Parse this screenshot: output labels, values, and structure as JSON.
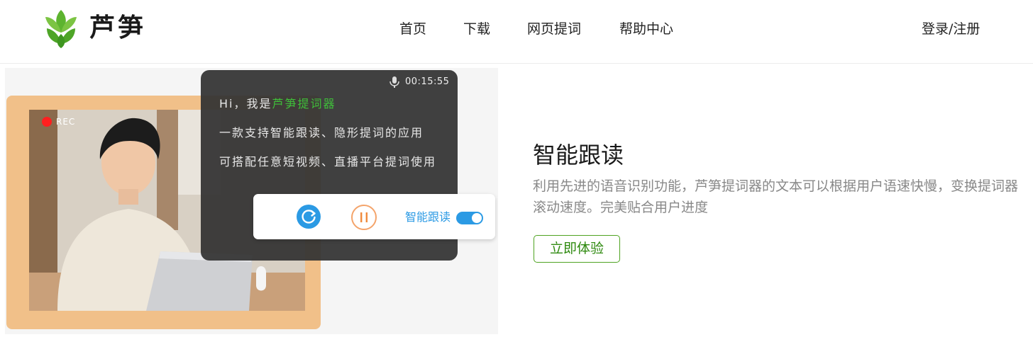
{
  "brand": {
    "name": "芦笋",
    "logo_icon": "leaf-logo-icon",
    "color": "#59b22e"
  },
  "nav": {
    "items": [
      {
        "label": "首页"
      },
      {
        "label": "下载"
      },
      {
        "label": "网页提词"
      },
      {
        "label": "帮助中心"
      }
    ],
    "login_label": "登录/注册"
  },
  "hero": {
    "rec_label": "REC",
    "timer": "00:15:55",
    "mic_icon": "microphone-icon",
    "script_lines": {
      "line1_prefix": "Hi，我是",
      "line1_brand": "芦笋提词器",
      "line2": "一款支持智能跟读、隐形提词的应用",
      "line3": "可搭配任意短视频、直播平台提词使用"
    },
    "controls": {
      "refresh_icon": "refresh-icon",
      "pause_icon": "pause-icon",
      "smart_follow_label": "智能跟读",
      "smart_follow_on": true
    }
  },
  "feature": {
    "title": "智能跟读",
    "description": "利用先进的语音识别功能，芦笋提词器的文本可以根据用户语速快慢，变换提词器滚动速度。完美贴合用户进度",
    "cta_label": "立即体验"
  },
  "colors": {
    "accent_green": "#3fbf3a",
    "cta_green": "#4fa321",
    "control_blue": "#2b9ae4",
    "pause_orange": "#f4a46b",
    "frame_orange": "#f1c089",
    "rec_red": "#ff1f1f"
  }
}
